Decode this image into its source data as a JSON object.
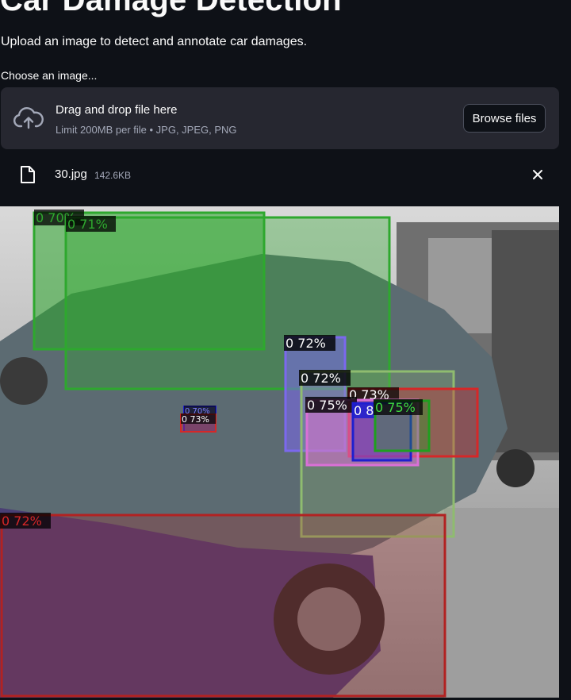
{
  "page": {
    "title": "Car Damage Detection",
    "subtitle": "Upload an image to detect and annotate car damages."
  },
  "uploader": {
    "label": "Choose an image...",
    "dropzone_text": "Drag and drop file here",
    "limit_text": "Limit 200MB per file • JPG, JPEG, PNG",
    "browse_label": "Browse files",
    "icon": "cloud-upload-icon"
  },
  "file": {
    "name": "30.jpg",
    "size": "142.6KB",
    "icon": "file-icon",
    "remove_icon": "close-icon"
  },
  "detections": [
    {
      "label": "0 70%",
      "color": "#2ea82e"
    },
    {
      "label": "0 71%",
      "color": "#2ea82e"
    },
    {
      "label": "0 72%",
      "color": "#7b68ee"
    },
    {
      "label": "0 72%",
      "color": "#8fbc6f"
    },
    {
      "label": "0 73%",
      "color": "#d62728"
    },
    {
      "label": "0 75%",
      "color": "#da70d6"
    },
    {
      "label": "0 8",
      "color": "#1f1fcf"
    },
    {
      "label": "0 75%",
      "color": "#1f9f1f"
    },
    {
      "label": "0 70%",
      "color": "#1f1fcf"
    },
    {
      "label": "0 73%",
      "color": "#d62728"
    },
    {
      "label": "0 72%",
      "color": "#b22222"
    }
  ]
}
